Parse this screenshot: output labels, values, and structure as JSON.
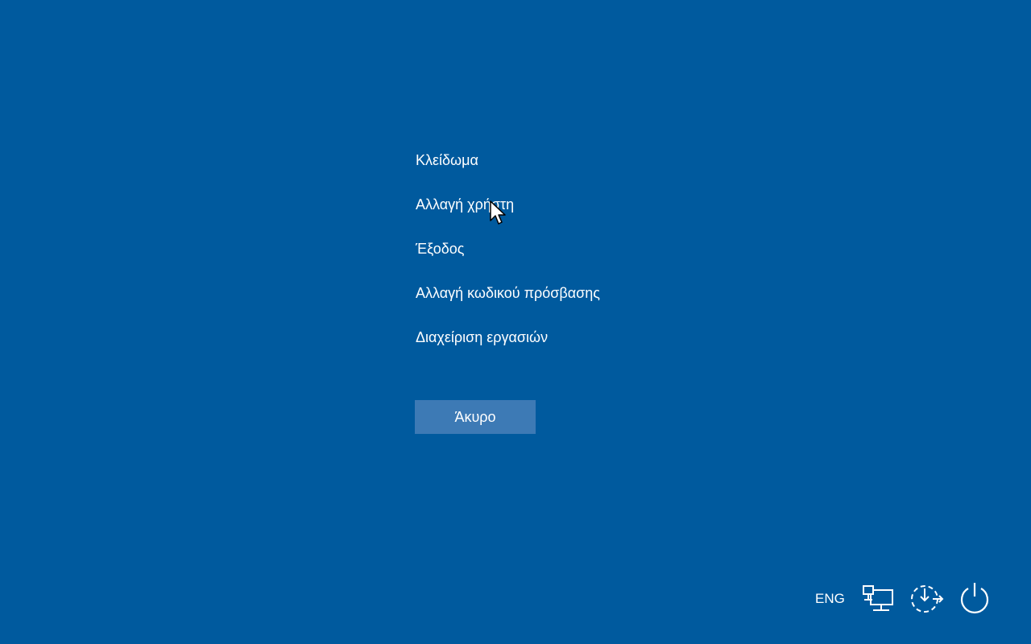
{
  "menu": {
    "items": [
      {
        "label": "Κλείδωμα"
      },
      {
        "label": "Αλλαγή χρήστη"
      },
      {
        "label": "Έξοδος"
      },
      {
        "label": "Αλλαγή κωδικού πρόσβασης"
      },
      {
        "label": "Διαχείριση εργασιών"
      }
    ]
  },
  "cancel": {
    "label": "Άκυρο"
  },
  "tray": {
    "language": "ENG",
    "icons": [
      "network-icon",
      "ease-of-access-icon",
      "power-icon"
    ]
  },
  "colors": {
    "background": "#005a9e",
    "button": "#3d7ab5",
    "text": "#ffffff"
  }
}
